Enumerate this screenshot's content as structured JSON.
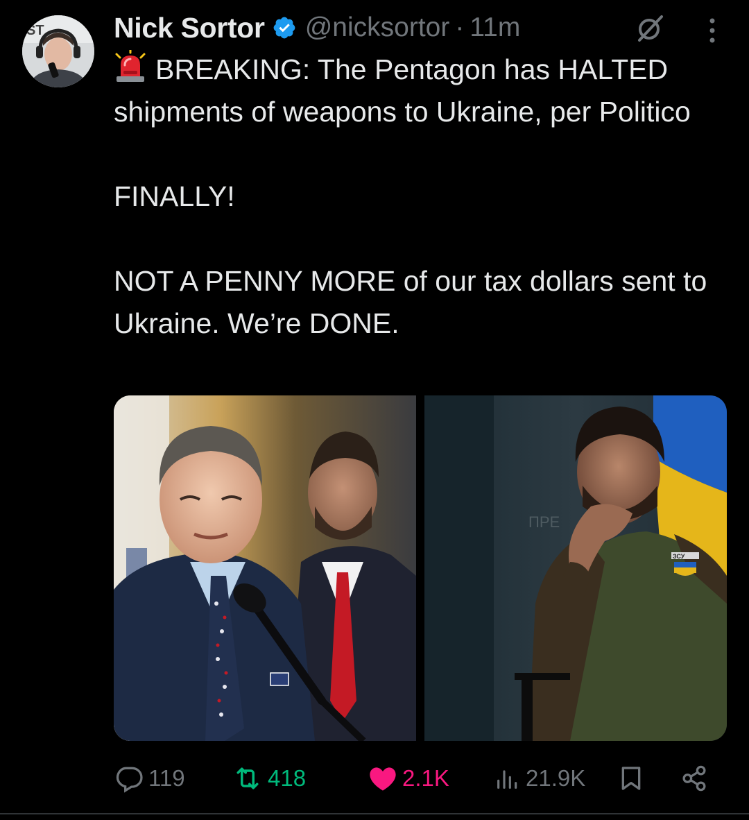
{
  "author": {
    "display_name": "Nick Sortor",
    "handle": "@nicksortor",
    "separator": "·",
    "time": "11m",
    "verified_icon": "verified-badge-icon",
    "avatar_badge_text": "ST"
  },
  "tweet": {
    "lines": [
      "BREAKING: The Pentagon has HALTED shipments of weapons to Ukraine, per Politico",
      "FINALLY!",
      "NOT A PENNY MORE of our tax dollars sent to Ukraine. We’re DONE."
    ],
    "leading_emoji": "police-car-light-icon"
  },
  "media": {
    "images": [
      {
        "name": "photo-left",
        "depicts": "man-at-microphone-with-man-in-red-tie"
      },
      {
        "name": "photo-right",
        "depicts": "man-in-olive-shirt-hand-to-chin-flag-background"
      }
    ],
    "right_shirt_patch_text": "ЗСУ"
  },
  "actions": {
    "replies": "119",
    "retweets": "418",
    "likes": "2.1K",
    "views": "21.9K"
  },
  "colors": {
    "background": "#000000",
    "text": "#e7e9ea",
    "muted": "#71767b",
    "verified": "#1d9bf0",
    "retweet": "#00ba7c",
    "like": "#f91880"
  }
}
